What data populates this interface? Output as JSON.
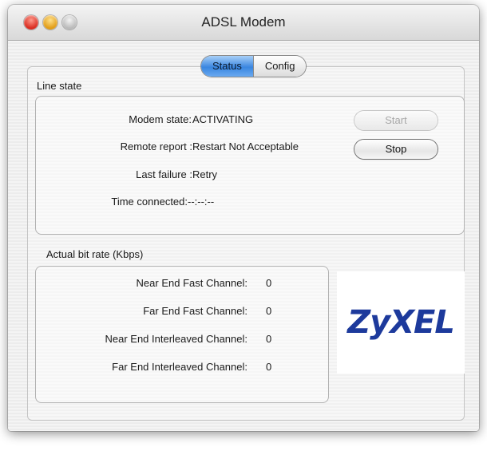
{
  "window": {
    "title": "ADSL Modem",
    "controls": [
      "close-icon",
      "minimize-icon",
      "zoom-icon"
    ]
  },
  "tabs": [
    {
      "label": "Status",
      "active": true
    },
    {
      "label": "Config",
      "active": false
    }
  ],
  "line_state": {
    "title": "Line state",
    "rows": [
      {
        "label": "Modem state:",
        "value": "ACTIVATING"
      },
      {
        "label": "Remote report :",
        "value": "Restart Not Acceptable"
      },
      {
        "label": "Last failure :",
        "value": "Retry"
      },
      {
        "label": "Time connected:",
        "value": "--:--:--"
      }
    ],
    "buttons": {
      "start": {
        "label": "Start",
        "enabled": false
      },
      "stop": {
        "label": "Stop",
        "enabled": true
      }
    }
  },
  "bit_rate": {
    "title": "Actual bit rate (Kbps)",
    "rows": [
      {
        "label": "Near End Fast Channel:",
        "value": "0"
      },
      {
        "label": "Far End Fast Channel:",
        "value": "0"
      },
      {
        "label": "Near End Interleaved Channel:",
        "value": "0"
      },
      {
        "label": "Far End Interleaved Channel:",
        "value": "0"
      }
    ]
  },
  "logo": {
    "text": "ZyXEL",
    "color": "#1d3a9c"
  },
  "colors": {
    "tab_active": "#3a86e0",
    "close": "#d8281c",
    "minimize": "#e09a12"
  }
}
